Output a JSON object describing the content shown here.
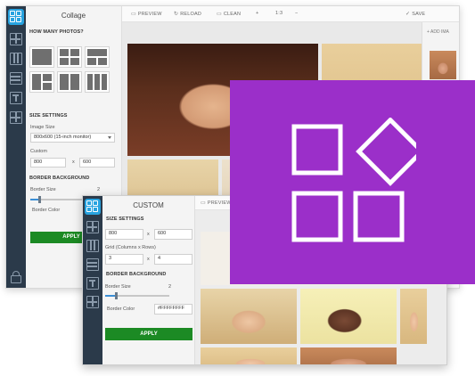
{
  "back": {
    "panel_title": "Collage",
    "how_many": "HOW MANY PHOTOS?",
    "size_settings": "SIZE SETTINGS",
    "image_size_label": "Image Size",
    "image_size_value": "800x600 (15-inch monitor)",
    "custom_label": "Custom",
    "width": "800",
    "x_sep": "x",
    "height": "600",
    "border_bg": "BORDER BACKGROUND",
    "border_size_label": "Border Size",
    "border_size_value": "2",
    "border_color_label": "Border Color",
    "apply": "APPLY",
    "toolbar": {
      "preview": "PREVIEW",
      "reload": "RELOAD",
      "clean": "CLEAN",
      "plus": "+",
      "ratio": "1:3",
      "minus": "−",
      "save": "SAVE"
    },
    "add_images": "+ ADD IMA"
  },
  "front": {
    "panel_title": "CUSTOM",
    "size_settings": "SIZE SETTINGS",
    "width": "800",
    "x_sep": "x",
    "height": "600",
    "grid_label": "Grid (Columns x Rows)",
    "cols": "3",
    "rows": "4",
    "border_bg": "BORDER BACKGROUND",
    "border_size_label": "Border Size",
    "border_size_value": "2",
    "border_color_label": "Border Color",
    "border_color_value": "#FFFFFFFF",
    "apply": "APPLY",
    "toolbar": {
      "preview": "PREVIEW"
    }
  },
  "colors": {
    "rail": "#2b3a4a",
    "logo": "#27a3e0",
    "apply": "#1c8a24",
    "overlay": "#9b2fc9"
  },
  "icons": [
    "grid-layout-icon",
    "columns-icon",
    "rows-icon",
    "text-layout-icon",
    "tiles-icon",
    "lock-icon",
    "preview-icon",
    "reload-icon",
    "clean-icon",
    "check-icon",
    "shapes-icon"
  ]
}
